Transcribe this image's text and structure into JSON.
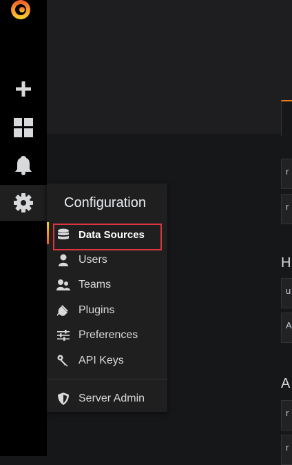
{
  "sidebar": {
    "icons": [
      "grafana-logo-icon",
      "plus-icon",
      "dashboards-icon",
      "bell-icon",
      "gear-icon"
    ]
  },
  "menu": {
    "title": "Configuration",
    "items": [
      {
        "label": "Data Sources",
        "icon": "database-icon",
        "active": true
      },
      {
        "label": "Users",
        "icon": "user-icon"
      },
      {
        "label": "Teams",
        "icon": "users-icon"
      },
      {
        "label": "Plugins",
        "icon": "plug-icon"
      },
      {
        "label": "Preferences",
        "icon": "sliders-icon"
      },
      {
        "label": "API Keys",
        "icon": "key-icon"
      }
    ],
    "admin": {
      "label": "Server Admin",
      "icon": "shield-icon"
    }
  },
  "background": {
    "row_chars": [
      "r",
      "r",
      "H",
      "u",
      "A",
      "A",
      "r",
      "r"
    ]
  },
  "colors": {
    "accent": "#eb7b18",
    "highlight": "#d9363e",
    "sidebar": "#000000",
    "menu_bg": "#1f1f20"
  }
}
